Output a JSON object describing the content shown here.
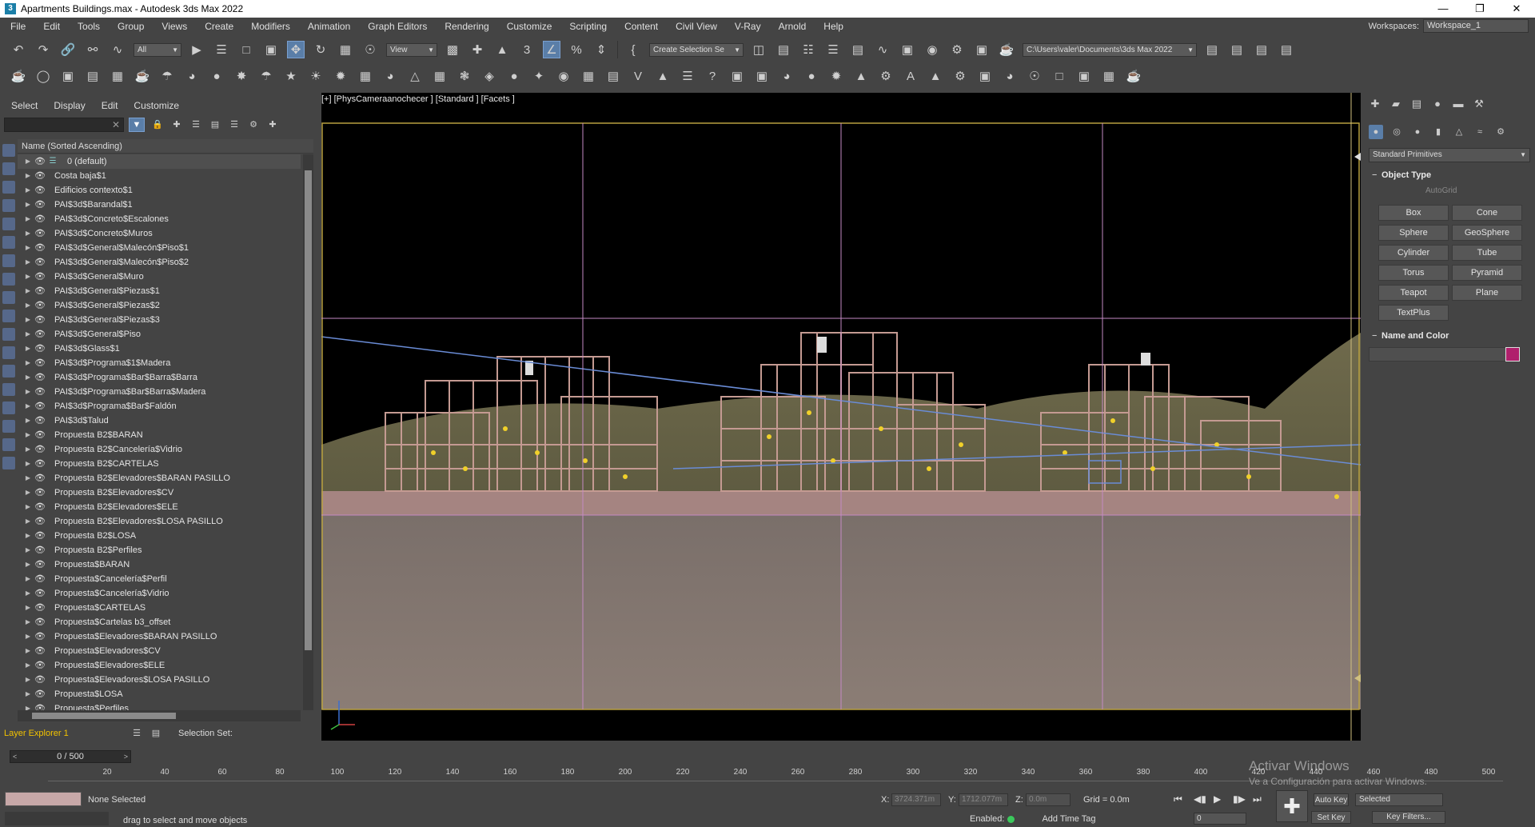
{
  "window": {
    "title": "Apartments Buildings.max - Autodesk 3ds Max 2022",
    "app_icon": "3"
  },
  "menu": [
    "File",
    "Edit",
    "Tools",
    "Group",
    "Views",
    "Create",
    "Modifiers",
    "Animation",
    "Graph Editors",
    "Rendering",
    "Customize",
    "Scripting",
    "Content",
    "Civil View",
    "V-Ray",
    "Arnold",
    "Help"
  ],
  "workspaces": {
    "label": "Workspaces:",
    "value": "Workspace_1"
  },
  "toolbar": {
    "filter_value": "All",
    "refcoord_value": "View",
    "named_selection": "Create Selection Se",
    "project_path": "C:\\Users\\valer\\Documents\\3ds Max 2022"
  },
  "scene_explorer": {
    "menu": [
      "Select",
      "Display",
      "Edit",
      "Customize"
    ],
    "column_header": "Name (Sorted Ascending)",
    "rows": [
      "0 (default)",
      "Costa baja$1",
      "Edificios contexto$1",
      "PAI$3d$Barandal$1",
      "PAI$3d$Concreto$Escalones",
      "PAI$3d$Concreto$Muros",
      "PAI$3d$General$Malecón$Piso$1",
      "PAI$3d$General$Malecón$Piso$2",
      "PAI$3d$General$Muro",
      "PAI$3d$General$Piezas$1",
      "PAI$3d$General$Piezas$2",
      "PAI$3d$General$Piezas$3",
      "PAI$3d$General$Piso",
      "PAI$3d$Glass$1",
      "PAI$3d$Programa$1$Madera",
      "PAI$3d$Programa$Bar$Barra$Barra",
      "PAI$3d$Programa$Bar$Barra$Madera",
      "PAI$3d$Programa$Bar$Faldón",
      "PAI$3d$Talud",
      "Propuesta B2$BARAN",
      "Propuesta B2$Cancelería$Vidrio",
      "Propuesta B2$CARTELAS",
      "Propuesta B2$Elevadores$BARAN PASILLO",
      "Propuesta B2$Elevadores$CV",
      "Propuesta B2$Elevadores$ELE",
      "Propuesta B2$Elevadores$LOSA PASILLO",
      "Propuesta B2$LOSA",
      "Propuesta B2$Perfiles",
      "Propuesta$BARAN",
      "Propuesta$Cancelería$Perfil",
      "Propuesta$Cancelería$Vidrio",
      "Propuesta$CARTELAS",
      "Propuesta$Cartelas b3_offset",
      "Propuesta$Elevadores$BARAN PASILLO",
      "Propuesta$Elevadores$CV",
      "Propuesta$Elevadores$ELE",
      "Propuesta$Elevadores$LOSA PASILLO",
      "Propuesta$LOSA",
      "Propuesta$Perfiles"
    ],
    "layer_explorer": "Layer Explorer 1",
    "selection_set_label": "Selection Set:"
  },
  "viewport": {
    "label": "[+] [PhysCameraanochecer ] [Standard ] [Facets ]"
  },
  "command_panel": {
    "category": "Standard Primitives",
    "object_type_title": "Object Type",
    "autogrid": "AutoGrid",
    "primitives": [
      "Box",
      "Cone",
      "Sphere",
      "GeoSphere",
      "Cylinder",
      "Tube",
      "Torus",
      "Pyramid",
      "Teapot",
      "Plane",
      "TextPlus"
    ],
    "name_color_title": "Name and Color",
    "object_color": "#b0206c"
  },
  "timeline": {
    "time_slider": "0 / 500",
    "ticks": [
      "20",
      "40",
      "60",
      "80",
      "100",
      "120",
      "140",
      "160",
      "180",
      "200",
      "220",
      "240",
      "260",
      "280",
      "300",
      "320",
      "340",
      "360",
      "380",
      "400",
      "420",
      "440",
      "460",
      "480",
      "500"
    ]
  },
  "status": {
    "selection": "None Selected",
    "prompt": "drag to select and move objects",
    "x_label": "X:",
    "x_value": "3724.371m",
    "y_label": "Y:",
    "y_value": "1712.077m",
    "z_label": "Z:",
    "z_value": "0.0m",
    "grid": "Grid = 0.0m",
    "enabled": "Enabled:",
    "add_time_tag": "Add Time Tag",
    "frame_value": "0",
    "auto_key": "Auto Key",
    "selected_dd": "Selected",
    "set_key": "Set Key",
    "key_filters": "Key Filters..."
  },
  "watermark": {
    "line1": "Activar Windows",
    "line2": "Ve a Configuración para activar Windows."
  }
}
